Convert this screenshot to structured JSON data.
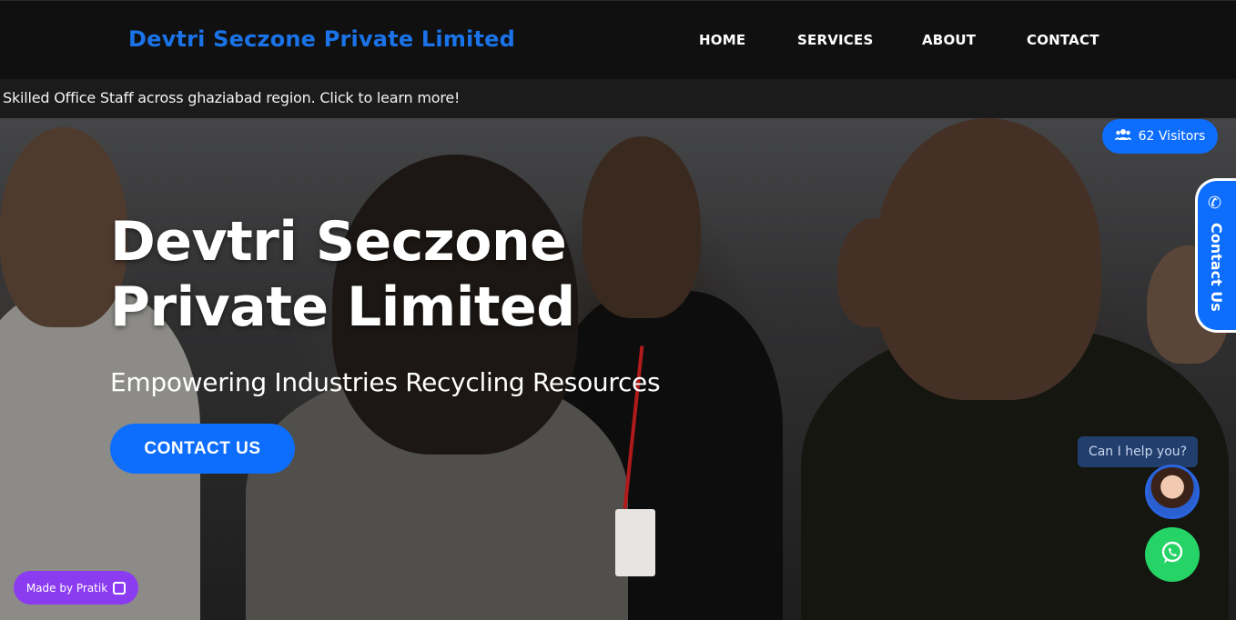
{
  "header": {
    "brand": "Devtri Seczone Private Limited",
    "nav": [
      {
        "label": "HOME"
      },
      {
        "label": "SERVICES"
      },
      {
        "label": "ABOUT"
      },
      {
        "label": "CONTACT"
      }
    ]
  },
  "ticker": {
    "text": "Skilled Office Staff across ghaziabad region. Click to learn more!"
  },
  "hero": {
    "title": "Devtri Seczone Private Limited",
    "subtitle": "Empowering Industries Recycling Resources",
    "cta_label": "CONTACT US"
  },
  "widgets": {
    "visitors_label": "62 Visitors",
    "contact_tab_label": "Contact Us",
    "chat_prompt": "Can I help you?",
    "made_by_label": "Made by Pratik"
  },
  "colors": {
    "brand": "#1a73e8",
    "accent": "#0d6efd",
    "whatsapp": "#25d366",
    "made_by": "#8b3cf0"
  },
  "icons": {
    "visitors": "users-icon",
    "contact_tab": "phone-icon",
    "whatsapp": "whatsapp-icon",
    "made_by": "pratik-logo-icon"
  }
}
